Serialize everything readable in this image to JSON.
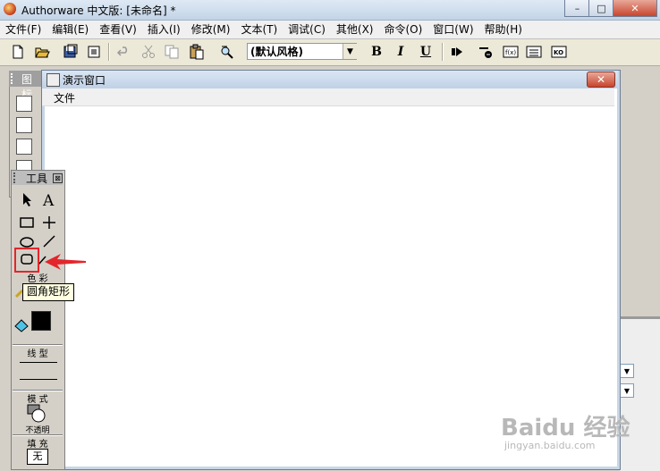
{
  "app": {
    "title": "Authorware 中文版: [未命名] *",
    "window_buttons": [
      "–",
      "□",
      "✕"
    ]
  },
  "menubar": {
    "items": [
      "文件(F)",
      "编辑(E)",
      "查看(V)",
      "插入(I)",
      "修改(M)",
      "文本(T)",
      "调试(C)",
      "其他(X)",
      "命令(O)",
      "窗口(W)",
      "帮助(H)"
    ]
  },
  "toolbar": {
    "style_value": "(默认风格)",
    "bold_label": "B",
    "italic_label": "I",
    "underline_label": "U"
  },
  "icon_palette": {
    "title": "图标"
  },
  "presentation_window": {
    "title": "演示窗口",
    "menu_file": "文件",
    "close_label": "✕"
  },
  "tools_panel": {
    "title": "工具",
    "close_label": "⊠",
    "section_color": "色 彩",
    "section_line": "线 型",
    "section_mode": "模 式",
    "mode_value": "不透明",
    "section_fill": "填 充",
    "fill_value": "无"
  },
  "tooltip": {
    "text": "圆角矩形"
  },
  "watermark": {
    "brand": "Baidu 经验",
    "url": "jingyan.baidu.com"
  },
  "colors": {
    "highlight": "#e3262b",
    "arrow": "#e3262b"
  }
}
